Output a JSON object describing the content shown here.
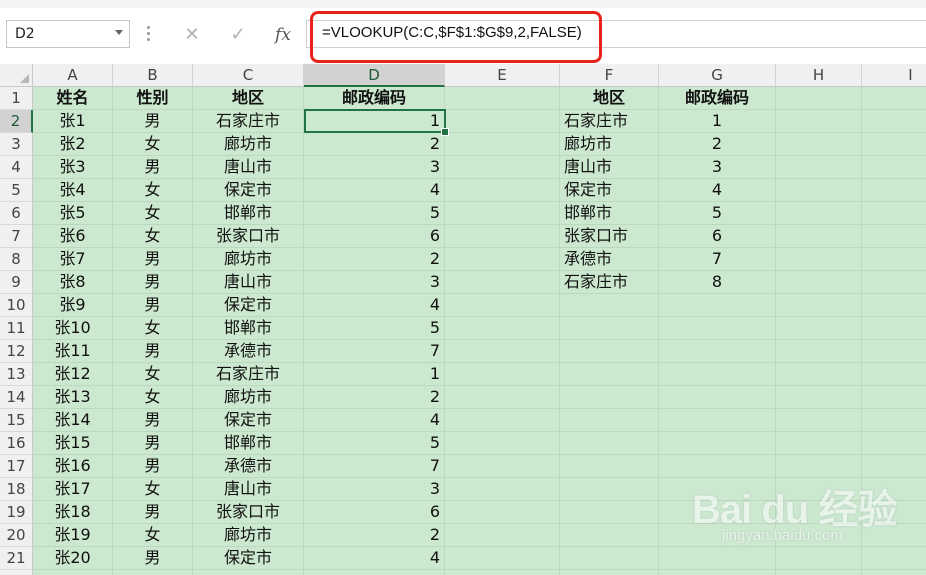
{
  "formula_bar": {
    "name_box": "D2",
    "cancel_icon": "✕",
    "enter_icon": "✓",
    "fx_label": "fx",
    "formula": "=VLOOKUP(C:C,$F$1:$G$9,2,FALSE)"
  },
  "columns": [
    "A",
    "B",
    "C",
    "D",
    "E",
    "F",
    "G",
    "H",
    "I"
  ],
  "selected_column": "D",
  "rows": [
    [
      "姓名",
      "性别",
      "地区",
      "邮政编码",
      "",
      "地区",
      "邮政编码"
    ],
    [
      "张1",
      "男",
      "石家庄市",
      "1",
      "",
      "石家庄市",
      "1"
    ],
    [
      "张2",
      "女",
      "廊坊市",
      "2",
      "",
      "廊坊市",
      "2"
    ],
    [
      "张3",
      "男",
      "唐山市",
      "3",
      "",
      "唐山市",
      "3"
    ],
    [
      "张4",
      "女",
      "保定市",
      "4",
      "",
      "保定市",
      "4"
    ],
    [
      "张5",
      "女",
      "邯郸市",
      "5",
      "",
      "邯郸市",
      "5"
    ],
    [
      "张6",
      "女",
      "张家口市",
      "6",
      "",
      "张家口市",
      "6"
    ],
    [
      "张7",
      "男",
      "廊坊市",
      "2",
      "",
      "承德市",
      "7"
    ],
    [
      "张8",
      "男",
      "唐山市",
      "3",
      "",
      "石家庄市",
      "8"
    ],
    [
      "张9",
      "男",
      "保定市",
      "4",
      "",
      "",
      ""
    ],
    [
      "张10",
      "女",
      "邯郸市",
      "5",
      "",
      "",
      ""
    ],
    [
      "张11",
      "男",
      "承德市",
      "7",
      "",
      "",
      ""
    ],
    [
      "张12",
      "女",
      "石家庄市",
      "1",
      "",
      "",
      ""
    ],
    [
      "张13",
      "女",
      "廊坊市",
      "2",
      "",
      "",
      ""
    ],
    [
      "张14",
      "男",
      "保定市",
      "4",
      "",
      "",
      ""
    ],
    [
      "张15",
      "男",
      "邯郸市",
      "5",
      "",
      "",
      ""
    ],
    [
      "张16",
      "男",
      "承德市",
      "7",
      "",
      "",
      ""
    ],
    [
      "张17",
      "女",
      "唐山市",
      "3",
      "",
      "",
      ""
    ],
    [
      "张18",
      "男",
      "张家口市",
      "6",
      "",
      "",
      ""
    ],
    [
      "张19",
      "女",
      "廊坊市",
      "2",
      "",
      "",
      ""
    ],
    [
      "张20",
      "男",
      "保定市",
      "4",
      "",
      "",
      ""
    ],
    [
      "",
      "",
      "",
      "",
      "",
      "",
      ""
    ]
  ],
  "watermark": {
    "logo": "Bai du 经验",
    "url": "jingyan.baidu.com"
  },
  "colors": {
    "cell_fill": "#cce8cf",
    "highlight_box": "#e8231c",
    "selection": "#217346"
  }
}
